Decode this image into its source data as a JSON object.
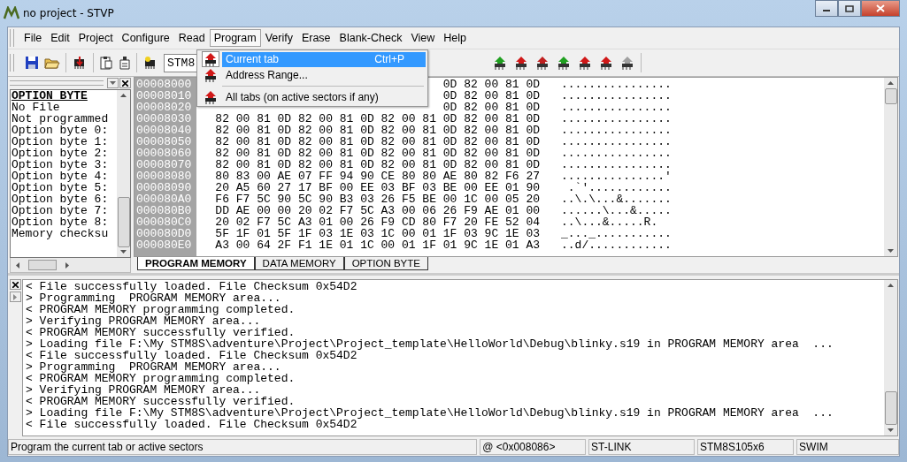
{
  "window": {
    "title": "no project - STVP"
  },
  "menubar": [
    {
      "label": "File",
      "selected": false
    },
    {
      "label": "Edit",
      "selected": false
    },
    {
      "label": "Project",
      "selected": false
    },
    {
      "label": "Configure",
      "selected": false
    },
    {
      "label": "Read",
      "selected": false
    },
    {
      "label": "Program",
      "selected": true
    },
    {
      "label": "Verify",
      "selected": false
    },
    {
      "label": "Erase",
      "selected": false
    },
    {
      "label": "Blank-Check",
      "selected": false
    },
    {
      "label": "View",
      "selected": false
    },
    {
      "label": "Help",
      "selected": false
    }
  ],
  "toolbar": {
    "device": "STM8"
  },
  "program_menu": [
    {
      "kind": "item",
      "label": "Current tab",
      "shortcut": "Ctrl+P",
      "selected": true
    },
    {
      "kind": "item",
      "label": "Address Range...",
      "selected": false
    },
    {
      "kind": "separator"
    },
    {
      "kind": "item",
      "label": "All tabs (on active sectors if any)",
      "selected": false
    }
  ],
  "option_panel": {
    "header": "OPTION BYTE",
    "items": [
      "No File",
      "Not programmed",
      "Option byte 0:",
      "Option byte 1:",
      "Option byte 2:",
      "Option byte 3:",
      "Option byte 4:",
      "Option byte 5:",
      "Option byte 6:",
      "Option byte 7:",
      "Option byte 8:",
      "Memory checksu"
    ]
  },
  "memory": {
    "rows": [
      {
        "address": "00008000",
        "bytes": "0D 82 00 81 0D",
        "ascii": "................"
      },
      {
        "address": "00008010",
        "bytes": "0D 82 00 81 0D",
        "ascii": "................"
      },
      {
        "address": "00008020",
        "bytes": "0D 82 00 81 0D",
        "ascii": "................"
      },
      {
        "address": "00008030",
        "bytes": "82 00 81 0D 82 00 81 0D 82 00 81 0D 82 00 81 0D",
        "ascii": "................"
      },
      {
        "address": "00008040",
        "bytes": "82 00 81 0D 82 00 81 0D 82 00 81 0D 82 00 81 0D",
        "ascii": "................"
      },
      {
        "address": "00008050",
        "bytes": "82 00 81 0D 82 00 81 0D 82 00 81 0D 82 00 81 0D",
        "ascii": "................"
      },
      {
        "address": "00008060",
        "bytes": "82 00 81 0D 82 00 81 0D 82 00 81 0D 82 00 81 0D",
        "ascii": "................"
      },
      {
        "address": "00008070",
        "bytes": "82 00 81 0D 82 00 81 0D 82 00 81 0D 82 00 81 0D",
        "ascii": "................"
      },
      {
        "address": "00008080",
        "bytes": "80 83 00 AE 07 FF 94 90 CE 80 80 AE 80 82 F6 27",
        "ascii": "...............'"
      },
      {
        "address": "00008090",
        "bytes": "20 A5 60 27 17 BF 00 EE 03 BF 03 BE 00 EE 01 90",
        "ascii": " .`'............"
      },
      {
        "address": "000080A0",
        "bytes": "F6 F7 5C 90 5C 90 B3 03 26 F5 BE 00 1C 00 05 20",
        "ascii": "..\\.\\...&......."
      },
      {
        "address": "000080B0",
        "bytes": "DD AE 00 00 20 02 F7 5C A3 00 06 26 F9 AE 01 00",
        "ascii": "......\\...&....."
      },
      {
        "address": "000080C0",
        "bytes": "20 02 F7 5C A3 01 00 26 F9 CD 80 F7 20 FE 52 04",
        "ascii": "..\\...&.....R."
      },
      {
        "address": "000080D0",
        "bytes": "5F 1F 01 5F 1F 03 1E 03 1C 00 01 1F 03 9C 1E 03",
        "ascii": "_..._..........."
      },
      {
        "address": "000080E0",
        "bytes": "A3 00 64 2F F1 1E 01 1C 00 01 1F 01 9C 1E 01 A3",
        "ascii": "..d/............"
      }
    ]
  },
  "memory_tabs": [
    {
      "label": "PROGRAM MEMORY",
      "selected": true
    },
    {
      "label": "DATA MEMORY",
      "selected": false
    },
    {
      "label": "OPTION BYTE",
      "selected": false
    }
  ],
  "log": [
    "< File successfully loaded. File Checksum 0x54D2",
    "> Programming  PROGRAM MEMORY area...",
    "< PROGRAM MEMORY programming completed.",
    "> Verifying PROGRAM MEMORY area...",
    "< PROGRAM MEMORY successfully verified.",
    "> Loading file F:\\My STM8S\\adventure\\Project\\Project_template\\HelloWorld\\Debug\\blinky.s19 in PROGRAM MEMORY area  ...",
    "< File successfully loaded. File Checksum 0x54D2",
    "> Programming  PROGRAM MEMORY area...",
    "< PROGRAM MEMORY programming completed.",
    "> Verifying PROGRAM MEMORY area...",
    "< PROGRAM MEMORY successfully verified.",
    "> Loading file F:\\My STM8S\\adventure\\Project\\Project_template\\HelloWorld\\Debug\\blinky.s19 in PROGRAM MEMORY area  ...",
    "< File successfully loaded. File Checksum 0x54D2"
  ],
  "status_bar": [
    "Program the current tab or active sectors",
    "@ <0x008086>",
    "ST-LINK",
    "STM8S105x6",
    "SWIM"
  ]
}
